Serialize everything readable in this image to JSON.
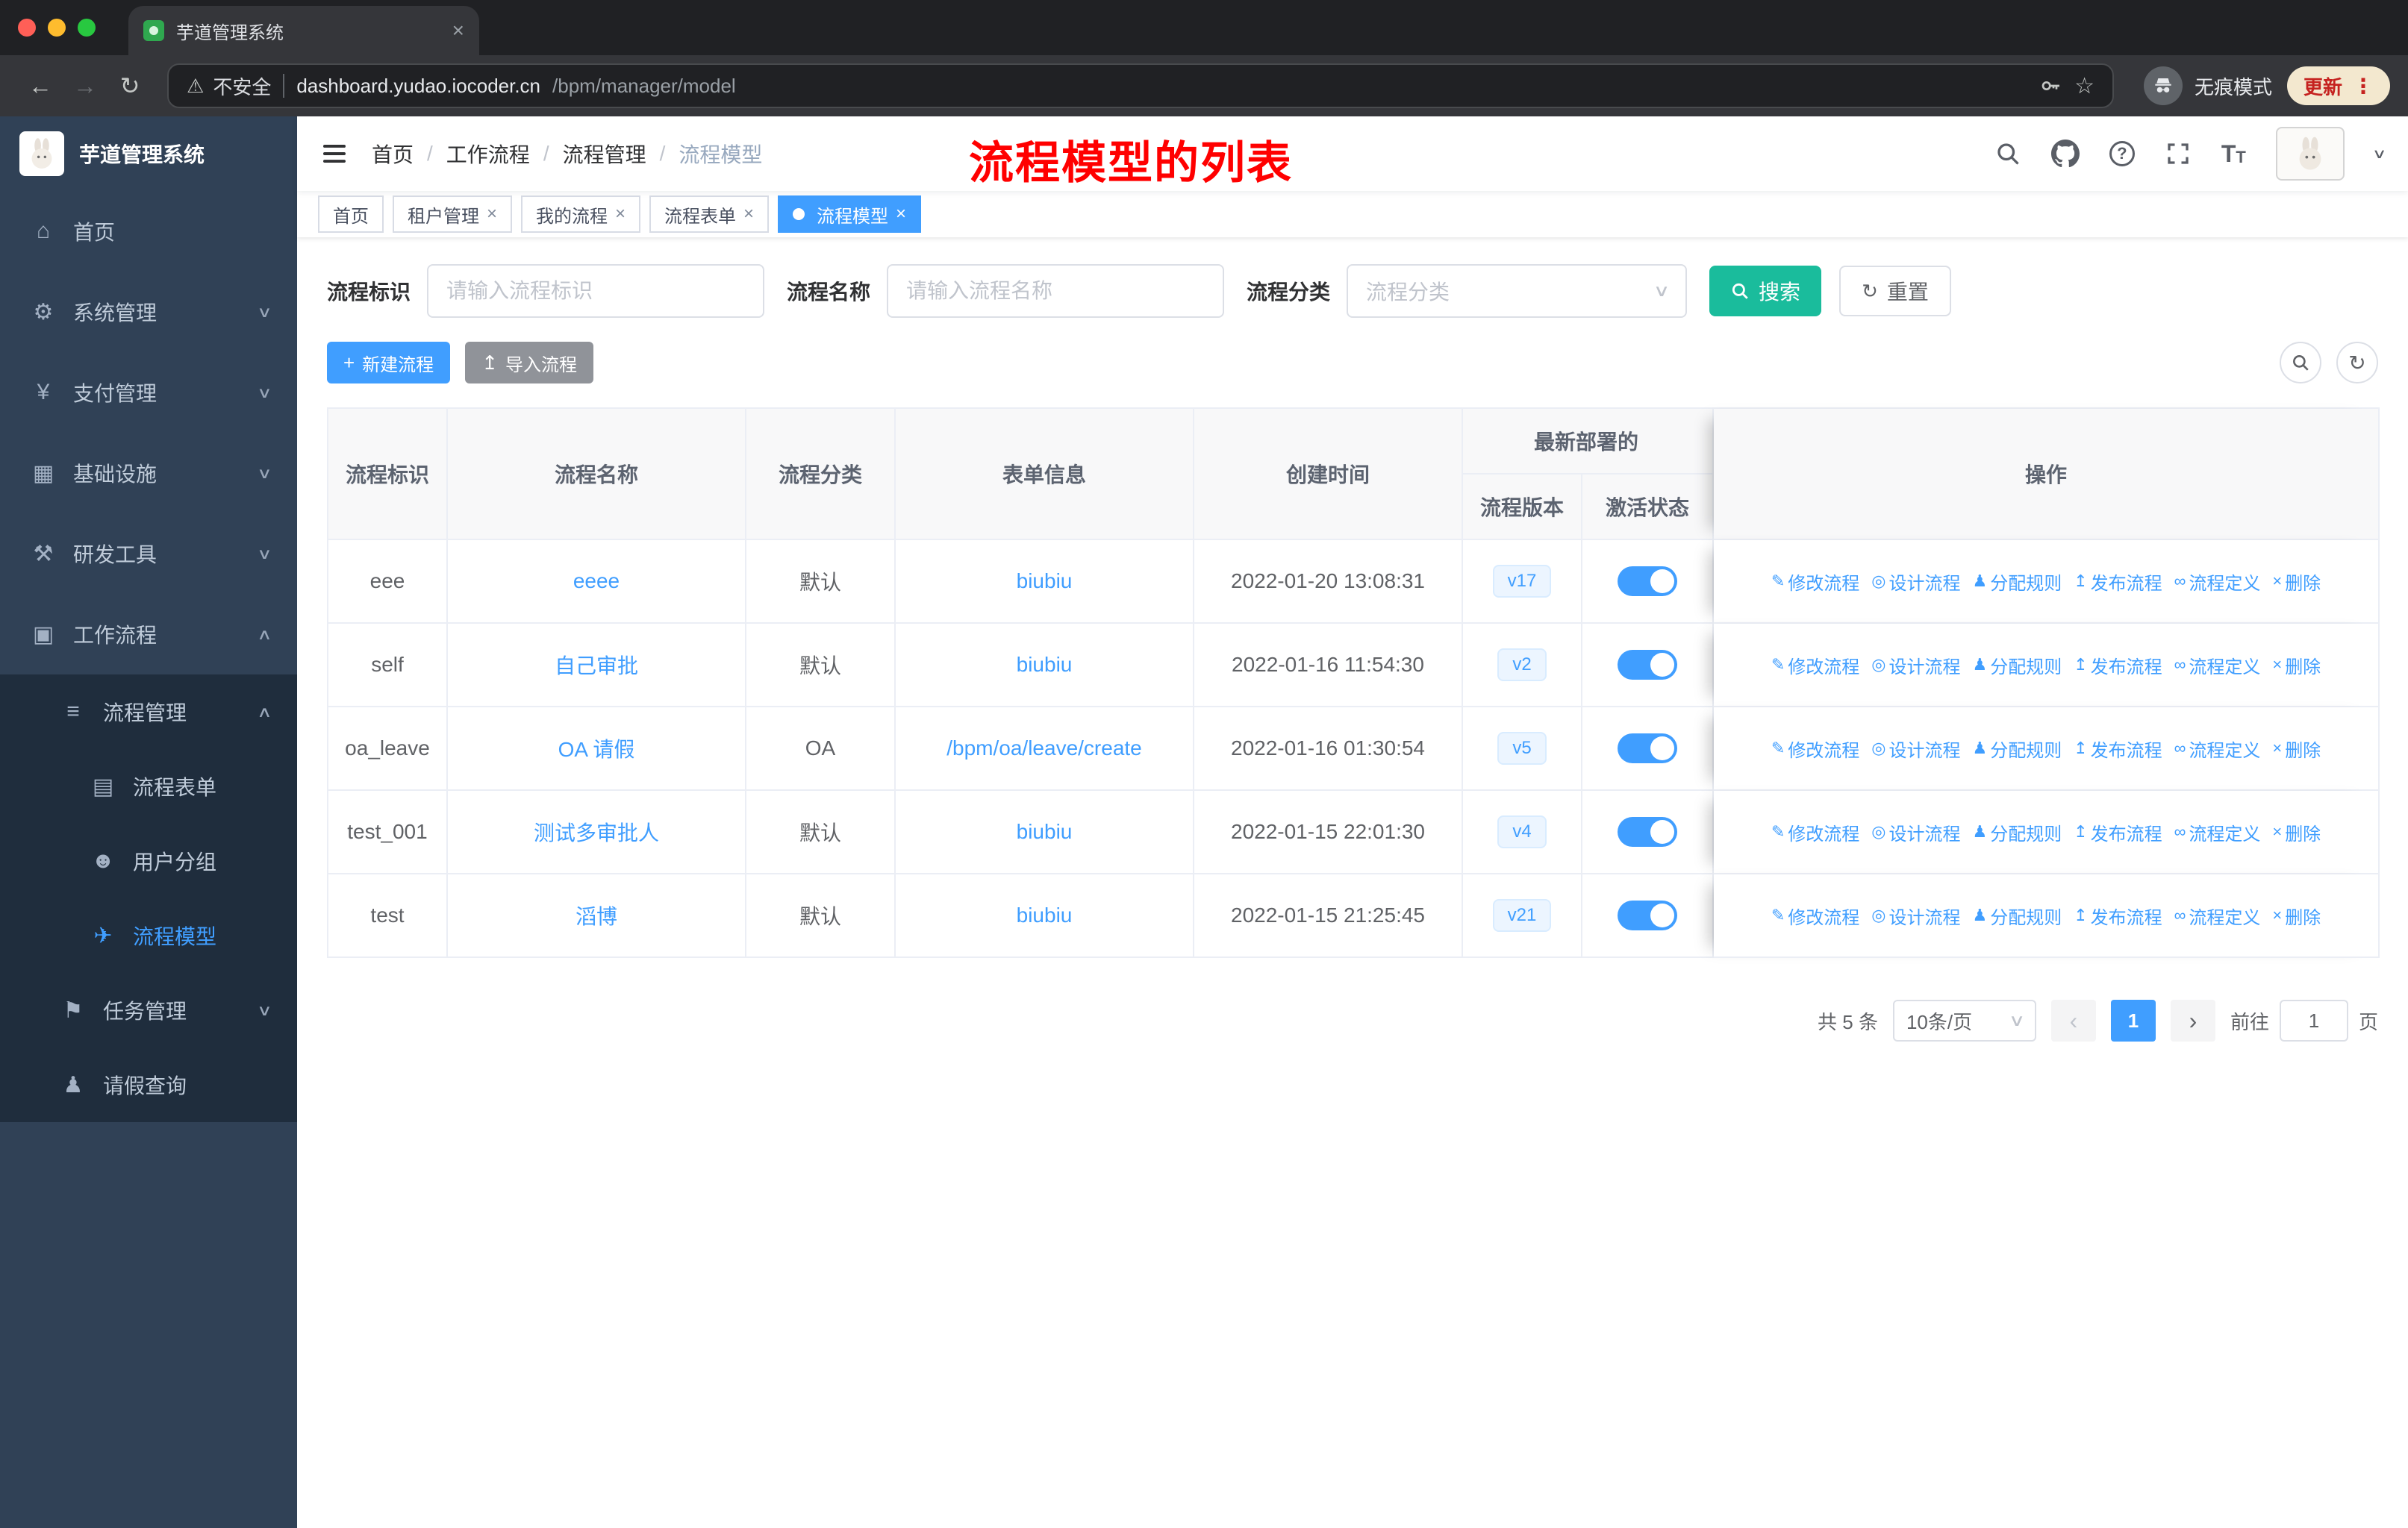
{
  "browser": {
    "tab_title": "芋道管理系统",
    "url_host": "dashboard.yudao.iocoder.cn",
    "url_path": "/bpm/manager/model",
    "security_label": "不安全",
    "incognito_label": "无痕模式",
    "update_label": "更新"
  },
  "ui": {
    "back": "←",
    "forward": "→",
    "reload": "↻",
    "warning": "⚠",
    "star": "☆",
    "dots": "⋮",
    "close": "×",
    "plus": "+",
    "chevron_down": "∨",
    "chevron_up": "∧",
    "caret": "▾",
    "prev": "‹",
    "next": "›",
    "question": "?",
    "letter_t": "T",
    "upload": "↥",
    "refresh": "↻",
    "slash": "/"
  },
  "sidebar": {
    "logo_title": "芋道管理系统",
    "items": [
      {
        "label": "首页",
        "icon": "⌂"
      },
      {
        "label": "系统管理",
        "icon": "⚙"
      },
      {
        "label": "支付管理",
        "icon": "¥"
      },
      {
        "label": "基础设施",
        "icon": "▦"
      },
      {
        "label": "研发工具",
        "icon": "⚒"
      },
      {
        "label": "工作流程",
        "icon": "▣"
      },
      {
        "label": "流程管理",
        "icon": "≡"
      },
      {
        "label": "流程表单",
        "icon": "▤"
      },
      {
        "label": "用户分组",
        "icon": "☻"
      },
      {
        "label": "流程模型",
        "icon": "✈"
      },
      {
        "label": "任务管理",
        "icon": "⚑"
      },
      {
        "label": "请假查询",
        "icon": "♟"
      }
    ]
  },
  "header": {
    "breadcrumbs": [
      "首页",
      "工作流程",
      "流程管理",
      "流程模型"
    ],
    "breadcrumb_separator": "/",
    "annotation": "流程模型的列表"
  },
  "tags": [
    {
      "label": "首页"
    },
    {
      "label": "租户管理"
    },
    {
      "label": "我的流程"
    },
    {
      "label": "流程表单"
    },
    {
      "label": "流程模型"
    }
  ],
  "filters": {
    "key_label": "流程标识",
    "key_placeholder": "请输入流程标识",
    "name_label": "流程名称",
    "name_placeholder": "请输入流程名称",
    "category_label": "流程分类",
    "category_placeholder": "流程分类",
    "search_label": "搜索",
    "reset_label": "重置"
  },
  "toolbar": {
    "create_label": "新建流程",
    "import_label": "导入流程"
  },
  "table": {
    "headers": {
      "key": "流程标识",
      "name": "流程名称",
      "category": "流程分类",
      "form": "表单信息",
      "created": "创建时间",
      "deploy_group": "最新部署的",
      "version": "流程版本",
      "state": "激活状态",
      "actions": "操作"
    },
    "action_labels": [
      "修改流程",
      "设计流程",
      "分配规则",
      "发布流程",
      "流程定义",
      "删除"
    ],
    "action_icons": [
      "✎",
      "◎",
      "♟",
      "↥",
      "∞",
      "×"
    ],
    "rows": [
      {
        "key": "eee",
        "name": "eeee",
        "category": "默认",
        "form": "biubiu",
        "created": "2022-01-20 13:08:31",
        "version": "v17",
        "active": true
      },
      {
        "key": "self",
        "name": "自己审批",
        "category": "默认",
        "form": "biubiu",
        "created": "2022-01-16 11:54:30",
        "version": "v2",
        "active": true
      },
      {
        "key": "oa_leave",
        "name": "OA 请假",
        "category": "OA",
        "form": "/bpm/oa/leave/create",
        "created": "2022-01-16 01:30:54",
        "version": "v5",
        "active": true
      },
      {
        "key": "test_001",
        "name": "测试多审批人",
        "category": "默认",
        "form": "biubiu",
        "created": "2022-01-15 22:01:30",
        "version": "v4",
        "active": true
      },
      {
        "key": "test",
        "name": "滔博",
        "category": "默认",
        "form": "biubiu",
        "created": "2022-01-15 21:25:45",
        "version": "v21",
        "active": true
      }
    ]
  },
  "pagination": {
    "total": "共 5 条",
    "page_size": "10条/页",
    "page": "1",
    "goto_label": "前往",
    "goto_value": "1",
    "page_unit": "页"
  },
  "colors": {
    "primary": "#409eff",
    "search_button": "#1abc9c",
    "sidebar_bg": "#304156",
    "annotation": "#ff0000"
  }
}
